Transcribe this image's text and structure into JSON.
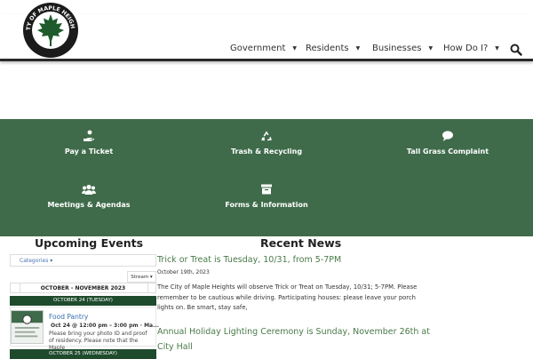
{
  "logo": {
    "text": "CITY OF MAPLE HEIGHTS"
  },
  "nav": {
    "items": [
      "Government",
      "Residents",
      "Businesses",
      "How Do I?"
    ],
    "caret": "▼"
  },
  "quick_links": [
    {
      "label": "Pay a Ticket",
      "icon": "hand-coin-icon"
    },
    {
      "label": "Trash & Recycling",
      "icon": "recycle-icon"
    },
    {
      "label": "Tall Grass Complaint",
      "icon": "comment-icon"
    },
    {
      "label": "Meetings & Agendas",
      "icon": "users-icon"
    },
    {
      "label": "Forms & Information",
      "icon": "archive-icon"
    }
  ],
  "events": {
    "heading": "Upcoming Events",
    "categories_label": "Categories ▾",
    "stream_label": "Stream ▾",
    "month_range": "OCTOBER - NOVEMBER 2023",
    "day1": "OCTOBER 24 (TUESDAY)",
    "event1": {
      "title": "Food Pantry",
      "time": "Oct 24 @ 12:00 pm – 3:00 pm · Ma...",
      "desc": "Please bring your photo ID and proof of residency.  Please note that the Maple"
    },
    "day2": "OCTOBER 25 (WEDNESDAY)"
  },
  "news": {
    "heading": "Recent News",
    "post1": {
      "title": "Trick or Treat is Tuesday, 10/31, from 5-7PM",
      "date": "October 19th, 2023",
      "body": "The City of Maple Heights will observe Trick or Treat on Tuesday, 10/31; 5-7PM.  Please remember to be cautious while driving.  Participating houses:  please leave your porch lights on.  Be smart, stay safe,"
    },
    "post2": {
      "title_line1": "Annual Holiday Lighting Ceremony is Sunday, November 26th at",
      "title_line2": "City Hall"
    }
  },
  "colors": {
    "band": "#3f6b4a",
    "day_bar": "#1f4b2d",
    "news_link": "#4a7a4a",
    "event_link": "#3b6db0"
  }
}
